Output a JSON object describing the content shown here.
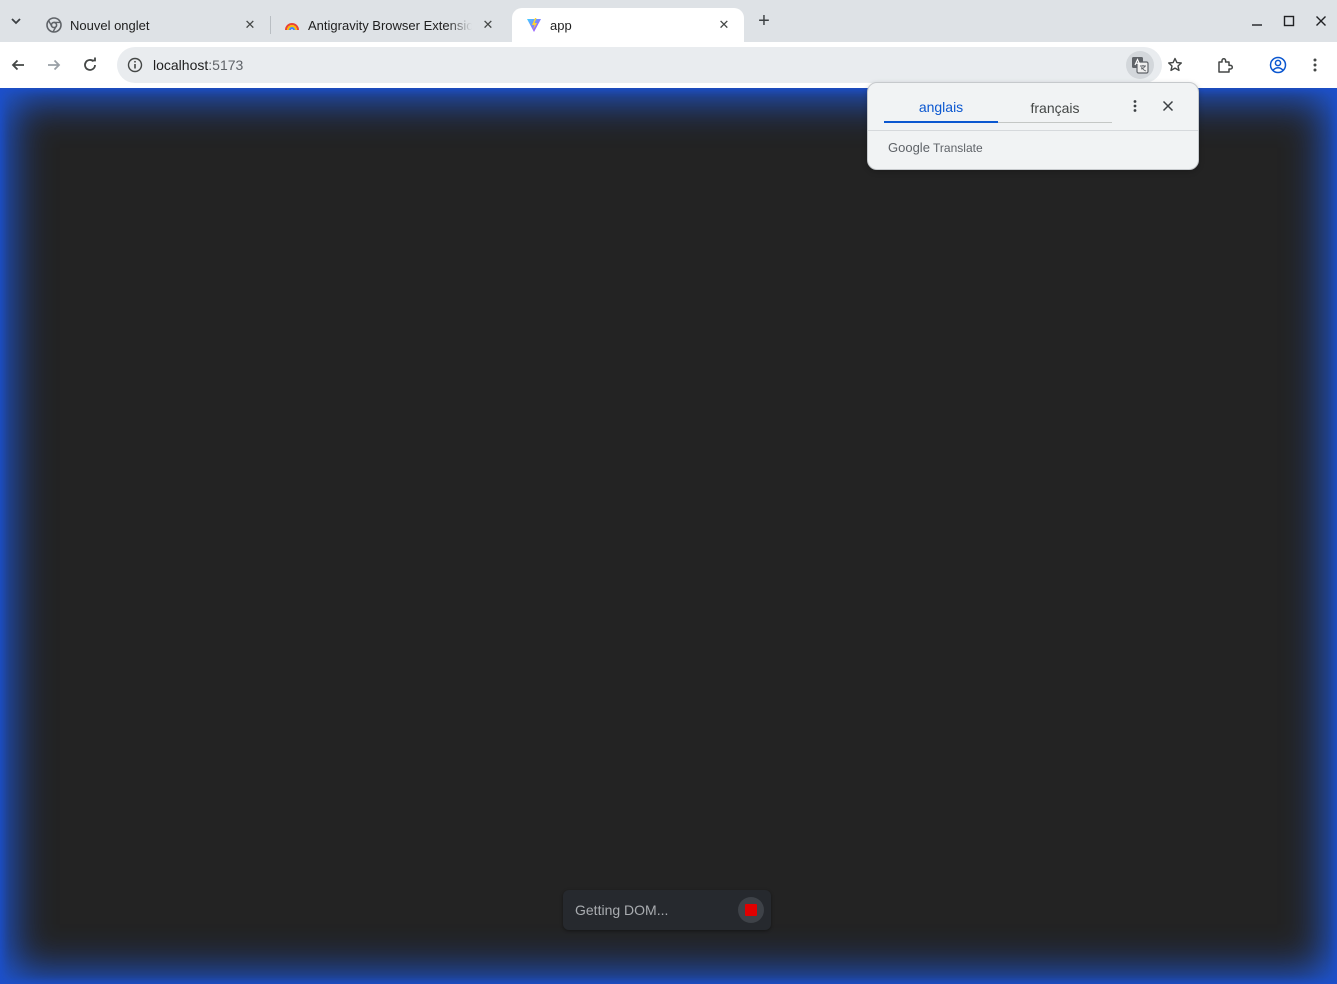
{
  "browser": {
    "tabs": [
      {
        "title": "Nouvel onglet",
        "icon": "chrome-icon"
      },
      {
        "title": "Antigravity Browser Extensio",
        "icon": "rainbow-icon"
      },
      {
        "title": "app",
        "icon": "vite-icon",
        "active": true
      }
    ],
    "new_tab_label": "+",
    "url": {
      "host": "localhost",
      "port": ":5173"
    }
  },
  "translate_popup": {
    "languages": [
      "anglais",
      "français"
    ],
    "selected": "anglais",
    "brand_google": "Google",
    "brand_translate": "Translate"
  },
  "status": {
    "text": "Getting DOM..."
  },
  "colors": {
    "glow": "#1f58d8",
    "viewport_bg": "#232323",
    "accent": "#0b57d0",
    "stop": "#e00000"
  }
}
